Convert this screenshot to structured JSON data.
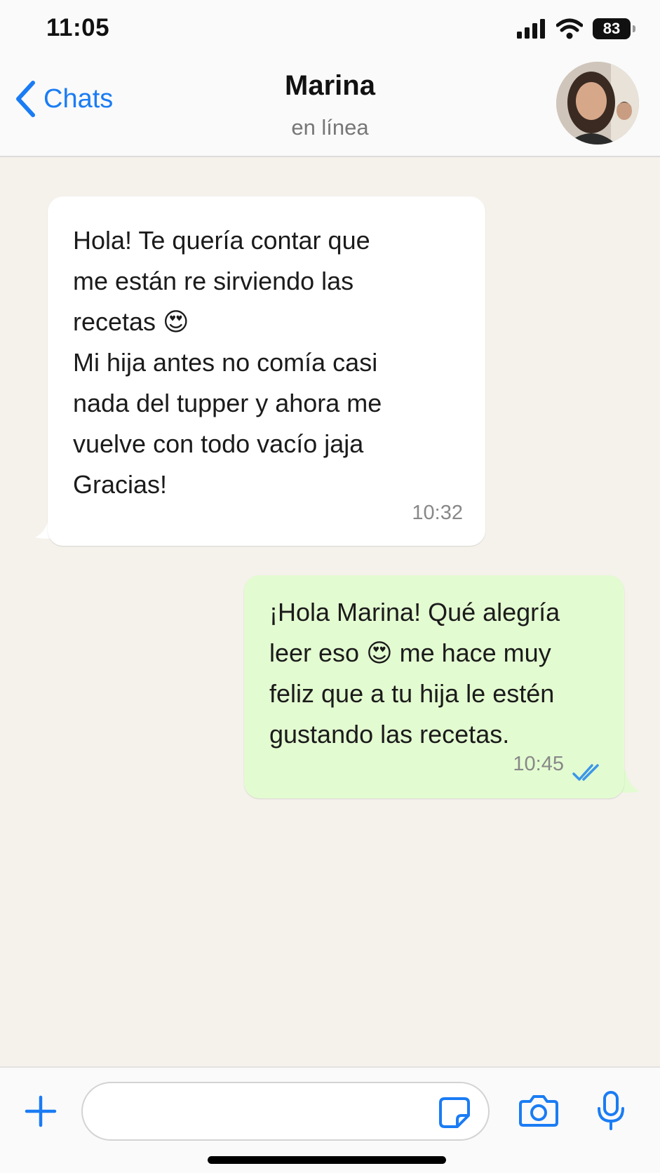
{
  "status_bar": {
    "time": "11:05",
    "battery": "83"
  },
  "header": {
    "back_label": "Chats",
    "contact_name": "Marina",
    "contact_status": "en línea"
  },
  "messages": [
    {
      "direction": "incoming",
      "lines": [
        "Hola! Te quería contar que",
        "me están re sirviendo las",
        "recetas 😍",
        "Mi hija antes no comía casi",
        "nada del tupper y ahora me",
        "vuelve con todo vacío jaja",
        "Gracias!"
      ],
      "time": "10:32"
    },
    {
      "direction": "outgoing",
      "lines": [
        "¡Hola Marina! Qué alegría",
        "leer eso 😍  me hace muy",
        "feliz que a tu hija le estén",
        "gustando las recetas."
      ],
      "time": "10:45",
      "status": "read"
    }
  ],
  "composer": {
    "placeholder": ""
  },
  "colors": {
    "accent": "#1a7cf4",
    "chat_background": "#f5f1eb",
    "incoming_bubble": "#ffffff",
    "outgoing_bubble": "#e3fbd1",
    "read_ticks": "#3b96e8"
  },
  "icons": [
    "signal-icon",
    "wifi-icon",
    "battery-icon",
    "back-chevron-icon",
    "plus-icon",
    "sticker-icon",
    "camera-icon",
    "microphone-icon",
    "double-check-icon"
  ]
}
